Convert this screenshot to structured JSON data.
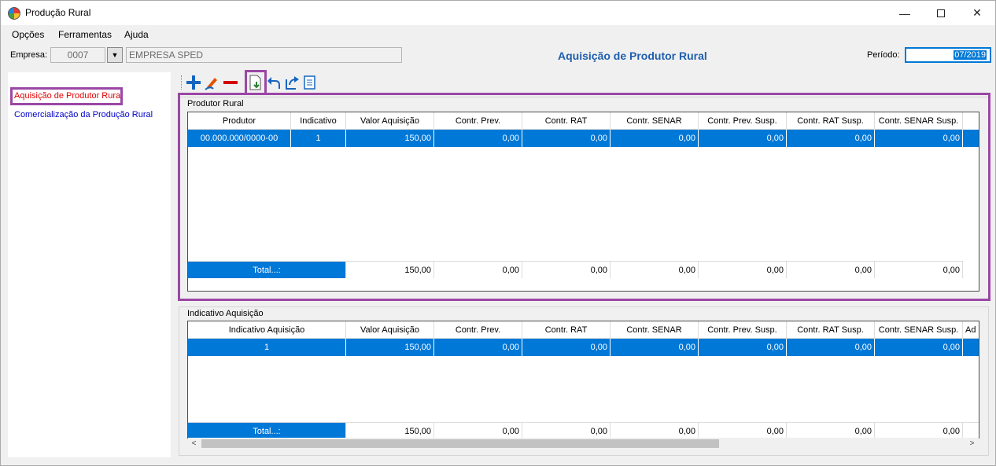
{
  "window": {
    "title": "Produção Rural",
    "minimize": "—",
    "close": "✕"
  },
  "menu": [
    "Opções",
    "Ferramentas",
    "Ajuda"
  ],
  "header": {
    "empresa_label": "Empresa:",
    "empresa_code": "0007",
    "empresa_dropdown": "▼",
    "empresa_name": "EMPRESA SPED",
    "screen_title": "Aquisição de Produtor Rural",
    "periodo_label": "Período:",
    "periodo_value": "07/2019"
  },
  "sidebar": {
    "items": [
      "Aquisição de Produtor Rural",
      "Comercialização da Produção Rural"
    ]
  },
  "toolbar": {
    "icons": [
      "add-icon",
      "edit-icon",
      "remove-icon",
      "import-icon",
      "undo-icon",
      "export-icon",
      "report-icon"
    ]
  },
  "produtor_panel": {
    "title": "Produtor Rural",
    "columns": [
      "Produtor",
      "Indicativo",
      "Valor Aquisição",
      "Contr. Prev.",
      "Contr. RAT",
      "Contr. SENAR",
      "Contr. Prev. Susp.",
      "Contr. RAT Susp.",
      "Contr. SENAR Susp."
    ],
    "rows": [
      [
        "00.000.000/0000-00",
        "1",
        "150,00",
        "0,00",
        "0,00",
        "0,00",
        "0,00",
        "0,00",
        "0,00"
      ]
    ],
    "total": [
      "Total...:",
      "150,00",
      "0,00",
      "0,00",
      "0,00",
      "0,00",
      "0,00",
      "0,00"
    ]
  },
  "indicativo_panel": {
    "title": "Indicativo Aquisição",
    "columns": [
      "Indicativo Aquisição",
      "Valor Aquisição",
      "Contr. Prev.",
      "Contr. RAT",
      "Contr. SENAR",
      "Contr. Prev. Susp.",
      "Contr. RAT Susp.",
      "Contr. SENAR Susp.",
      "Ad"
    ],
    "rows": [
      [
        "1",
        "150,00",
        "0,00",
        "0,00",
        "0,00",
        "0,00",
        "0,00",
        "0,00",
        ""
      ]
    ],
    "total": [
      "Total...:",
      "150,00",
      "0,00",
      "0,00",
      "0,00",
      "0,00",
      "0,00",
      "0,00",
      ""
    ]
  },
  "colors": {
    "accent": "#0078d7",
    "highlight": "#9b47a5",
    "title": "#1f5fae"
  }
}
